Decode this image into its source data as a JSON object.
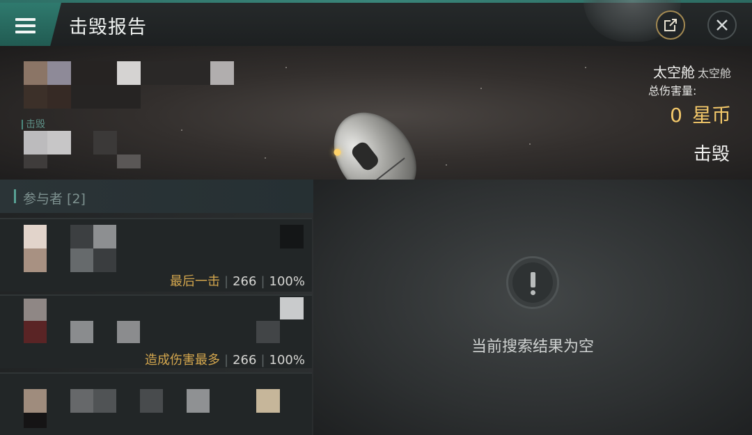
{
  "header": {
    "title": "击毁报告",
    "menu_icon": "hamburger-menu-icon",
    "share_icon": "share-external-icon",
    "close_icon": "close-icon"
  },
  "banner": {
    "killed_tag": "击毁",
    "victim_name": "太空舱",
    "victim_type": "太空舱",
    "damage_label": "总伤害量:",
    "damage_value": "0",
    "damage_unit": "星币",
    "status": "击毁"
  },
  "participants": {
    "header": "参与者 [2]",
    "rows": [
      {
        "role": "最后一击",
        "damage": "266",
        "percent": "100%"
      },
      {
        "role": "造成伤害最多",
        "damage": "266",
        "percent": "100%"
      },
      {
        "role": "",
        "damage": "",
        "percent": ""
      }
    ]
  },
  "empty_state": {
    "icon": "alert-exclamation-icon",
    "text": "当前搜索结果为空"
  },
  "colors": {
    "accent_teal": "#2f7a6e",
    "gold": "#f3c86a",
    "role_gold": "#d4a74e"
  }
}
